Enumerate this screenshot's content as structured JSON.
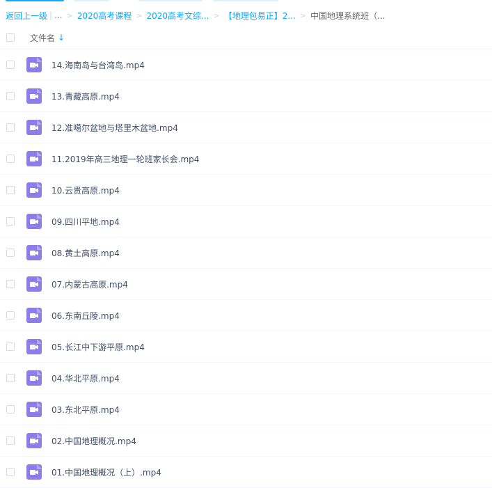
{
  "breadcrumb": {
    "back": "返回上一级",
    "pipe": "|",
    "ellipsis": "...",
    "items": [
      "2020高考课程",
      "2020高考文综...",
      "【地理包易正】2...",
      "中国地理系统班（..."
    ]
  },
  "header": {
    "column_label": "文件名",
    "sort_glyph": "↓"
  },
  "colors": {
    "accent": "#09aaff",
    "video_icon": "#8c7ee8"
  },
  "files": [
    "14.海南岛与台湾岛.mp4",
    "13.青藏高原.mp4",
    "12.准噶尔盆地与塔里木盆地.mp4",
    "11.2019年高三地理一轮班家长会.mp4",
    "10.云贵高原.mp4",
    "09.四川平地.mp4",
    "08.黄土高原.mp4",
    "07.内蒙古高原.mp4",
    "06.东南丘陵.mp4",
    "05.长江中下游平原.mp4",
    "04.华北平原.mp4",
    "03.东北平原.mp4",
    "02.中国地理概况.mp4",
    "01.中国地理概况（上）.mp4"
  ]
}
